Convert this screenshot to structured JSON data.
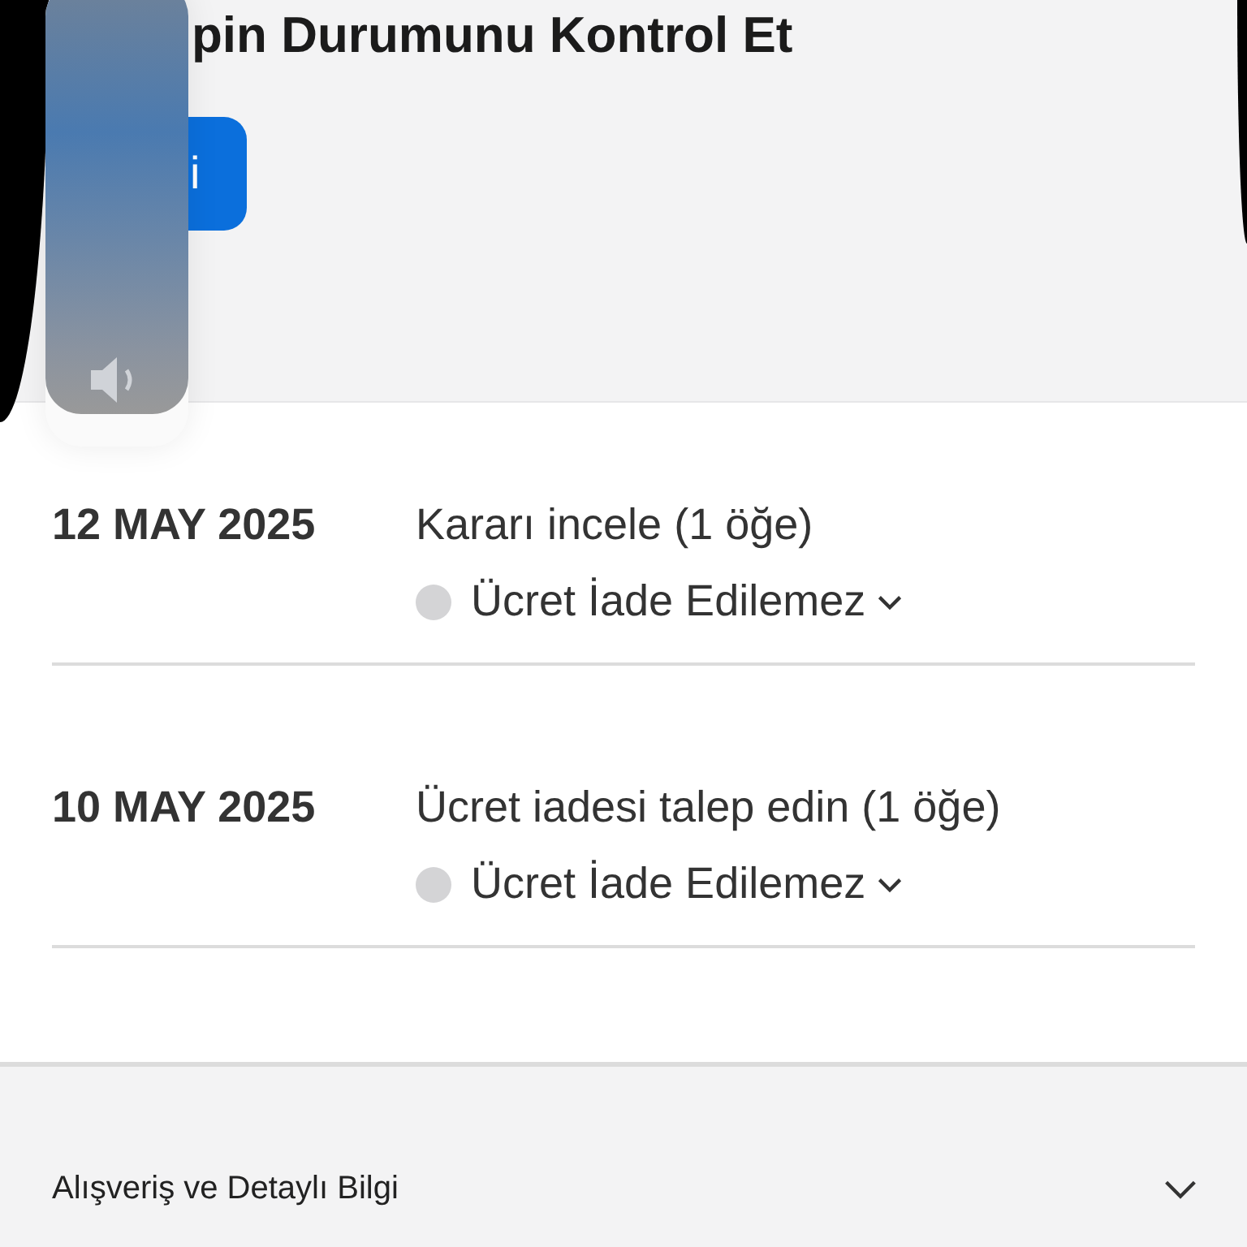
{
  "header": {
    "title": "pin Durumunu Kontrol Et",
    "button": "i"
  },
  "volume_hud": {
    "level": 0.93
  },
  "events": [
    {
      "date": "12 MAY 2025",
      "title": "Kararı incele (1 öğe)",
      "status": "Ücret İade Edilemez"
    },
    {
      "date": "10 MAY 2025",
      "title": "Ücret iadesi talep edin (1 öğe)",
      "status": "Ücret İade Edilemez"
    }
  ],
  "details": {
    "label": "Alışveriş ve Detaylı Bilgi",
    "expanded": false
  }
}
